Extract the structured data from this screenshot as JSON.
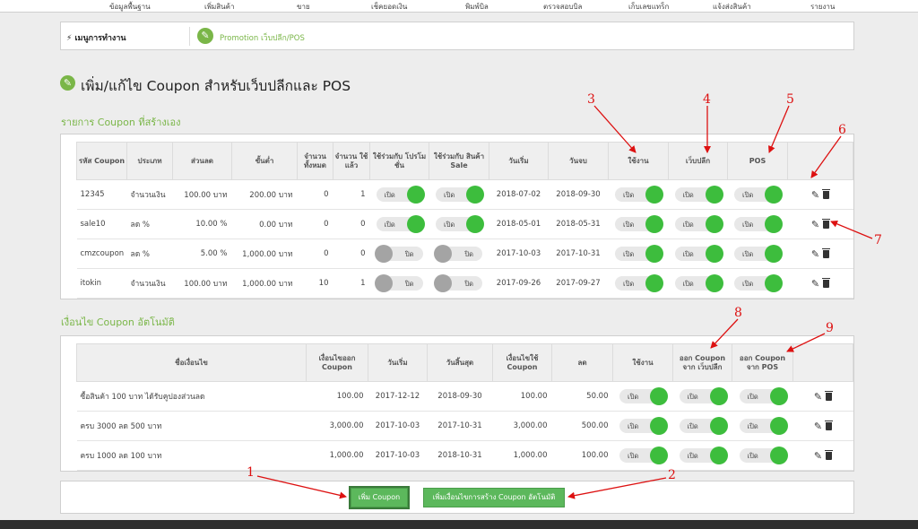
{
  "topnav": [
    "ข้อมูลพื้นฐาน",
    "เพิ่มสินค้า",
    "ขาย",
    "เช็คยอดเงิน",
    "พิมพ์บิล",
    "ตรวจสอบบิล",
    "เก็บเลขแทร็ก",
    "แจ้งส่งสินค้า",
    "รายงาน"
  ],
  "menubar": {
    "title": "⚡ เมนูการทำงาน",
    "crumb": "Promotion เว็บปลีก/POS",
    "crumb_icon": "tag-icon"
  },
  "page_title": "เพิ่ม/แก้ไข Coupon สำหรับเว็บปลีกและ POS",
  "section1": {
    "title": "รายการ Coupon ที่สร้างเอง",
    "headers": [
      "รหัส Coupon",
      "ประเภท",
      "ส่วนลด",
      "ขั้นต่ำ",
      "จำนวน ทั้งหมด",
      "จำนวน ใช้แล้ว",
      "ใช้ร่วมกับ โปรโมชั่น",
      "ใช้ร่วมกับ สินค้า Sale",
      "วันเริ่ม",
      "วันจบ",
      "ใช้งาน",
      "เว็บปลีก",
      "POS",
      ""
    ],
    "rows": [
      {
        "code": "12345",
        "type": "จำนวนเงิน",
        "discount": "100.00 บาท",
        "minimum": "200.00 บาท",
        "total": "0",
        "used": "1",
        "promo": "on",
        "sale": "on",
        "start": "2018-07-02",
        "end": "2018-09-30",
        "active": "on",
        "web": "on",
        "pos": "on"
      },
      {
        "code": "sale10",
        "type": "ลด %",
        "discount": "10.00 %",
        "minimum": "0.00 บาท",
        "total": "0",
        "used": "0",
        "promo": "on",
        "sale": "on",
        "start": "2018-05-01",
        "end": "2018-05-31",
        "active": "on",
        "web": "on",
        "pos": "on"
      },
      {
        "code": "cmzcoupon",
        "type": "ลด %",
        "discount": "5.00 %",
        "minimum": "1,000.00 บาท",
        "total": "0",
        "used": "0",
        "promo": "off",
        "sale": "off",
        "start": "2017-10-03",
        "end": "2017-10-31",
        "active": "on",
        "web": "on",
        "pos": "on"
      },
      {
        "code": "itokin",
        "type": "จำนวนเงิน",
        "discount": "100.00 บาท",
        "minimum": "1,000.00 บาท",
        "total": "10",
        "used": "1",
        "promo": "off",
        "sale": "off",
        "start": "2017-09-26",
        "end": "2017-09-27",
        "active": "on",
        "web": "on",
        "pos": "on"
      }
    ]
  },
  "section2": {
    "title": "เงื่อนไข Coupon อัตโนมัติ",
    "headers": [
      "ชื่อเงื่อนไข",
      "เงื่อนไขออก Coupon",
      "วันเริ่ม",
      "วันสิ้นสุด",
      "เงื่อนไขใช้ Coupon",
      "ลด",
      "ใช้งาน",
      "ออก Coupon จาก เว็บปลีก",
      "ออก Coupon จาก POS",
      ""
    ],
    "rows": [
      {
        "name": "ซื้อสินค้า 100 บาท ได้รับคูปองส่วนลด",
        "issue": "100.00",
        "start": "2017-12-12",
        "end": "2018-09-30",
        "use": "100.00",
        "discount": "50.00",
        "active": "on",
        "web": "on",
        "pos": "on"
      },
      {
        "name": "ครบ 3000 ลด 500 บาท",
        "issue": "3,000.00",
        "start": "2017-10-03",
        "end": "2017-10-31",
        "use": "3,000.00",
        "discount": "500.00",
        "active": "on",
        "web": "on",
        "pos": "on"
      },
      {
        "name": "ครบ 1000 ลด 100 บาท",
        "issue": "1,000.00",
        "start": "2017-10-03",
        "end": "2018-10-31",
        "use": "1,000.00",
        "discount": "100.00",
        "active": "on",
        "web": "on",
        "pos": "on"
      }
    ]
  },
  "toggle_labels": {
    "on": "เปิด",
    "off": "ปิด"
  },
  "buttons": {
    "add_coupon": "เพิ่ม Coupon",
    "add_condition": "เพิ่มเงื่อนไขการสร้าง Coupon อัตโนมัติ"
  },
  "annotations": [
    "1",
    "2",
    "3",
    "4",
    "5",
    "6",
    "7",
    "8",
    "9"
  ],
  "colors": {
    "accent_green": "#7ab648",
    "toggle_on": "#3dbd3d",
    "toggle_off": "#a4a4a4",
    "button_green": "#5cb85c",
    "annotation_red": "#dd1111"
  }
}
